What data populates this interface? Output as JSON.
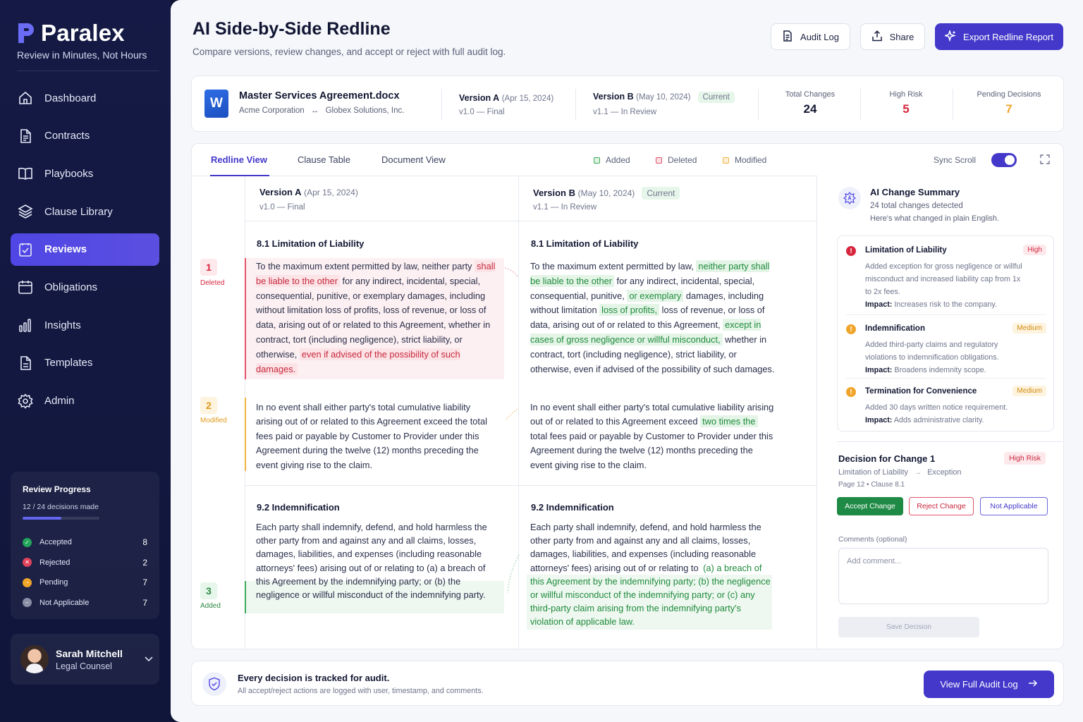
{
  "brand": {
    "name": "Paralex",
    "tagline": "Review in Minutes, Not Hours"
  },
  "nav": [
    {
      "label": "Dashboard",
      "icon": "home-icon"
    },
    {
      "label": "Contracts",
      "icon": "document-icon"
    },
    {
      "label": "Playbooks",
      "icon": "book-icon"
    },
    {
      "label": "Clause Library",
      "icon": "layers-icon"
    },
    {
      "label": "Reviews",
      "icon": "check-square-icon",
      "active": true
    },
    {
      "label": "Obligations",
      "icon": "calendar-icon"
    },
    {
      "label": "Insights",
      "icon": "bar-chart-icon"
    },
    {
      "label": "Templates",
      "icon": "file-icon"
    },
    {
      "label": "Admin",
      "icon": "gear-icon"
    }
  ],
  "progress": {
    "title": "Review Progress",
    "summary": "12 / 24 decisions made",
    "fraction": 0.5,
    "rows": [
      {
        "label": "Accepted",
        "count": "8",
        "color": "#22a55a"
      },
      {
        "label": "Rejected",
        "count": "2",
        "color": "#e0425a"
      },
      {
        "label": "Pending",
        "count": "7",
        "color": "#f0a52a"
      },
      {
        "label": "Not Applicable",
        "count": "7",
        "color": "#8a8fa6"
      }
    ]
  },
  "user": {
    "name": "Sarah Mitchell",
    "role": "Legal Counsel"
  },
  "header": {
    "title": "AI Side-by-Side Redline",
    "subtitle": "Compare versions, review changes, and accept or reject with full audit log.",
    "audit_label": "Audit Log",
    "share_label": "Share",
    "export_label": "Export Redline Report"
  },
  "doc": {
    "icon_letter": "W",
    "name": "Master Services Agreement.docx",
    "party_a": "Acme Corporation",
    "party_sep": "↔",
    "party_b": "Globex Solutions, Inc.",
    "version_a_label": "Version A",
    "version_a_date": "(Apr 15, 2024)",
    "version_a_sub": "v1.0 — Final",
    "version_b_label": "Version B",
    "version_b_date": "(May 10, 2024)",
    "version_b_sub": "v1.1 — In Review",
    "current_badge": "Current",
    "stats": [
      {
        "label": "Total Changes",
        "value": "24",
        "color": "#131833"
      },
      {
        "label": "High Risk",
        "value": "5",
        "color": "#d7263d"
      },
      {
        "label": "Pending Decisions",
        "value": "7",
        "color": "#f0a52a"
      }
    ]
  },
  "tabs": [
    "Redline View",
    "Clause Table",
    "Document View"
  ],
  "legend": [
    {
      "label": "Added",
      "color": "#3caa5a",
      "bg": "#dff3e3"
    },
    {
      "label": "Deleted",
      "color": "#e0526a",
      "bg": "#fbe0e4"
    },
    {
      "label": "Modified",
      "color": "#f1b341",
      "bg": "#fdf0d6"
    }
  ],
  "sync_label": "Sync Scroll",
  "changes": [
    {
      "num": "1",
      "label": "Deleted",
      "color": "#d7263d",
      "bg": "#fde9ec"
    },
    {
      "num": "2",
      "label": "Modified",
      "color": "#e09a1c",
      "bg": "#fdf3df"
    },
    {
      "num": "3",
      "label": "Added",
      "color": "#2f8a45",
      "bg": "#e6f6ea"
    }
  ],
  "clauses": {
    "s81": "8.1  Limitation of Liability",
    "s92": "9.2  Indemnification",
    "a1_pre": "To the maximum extent permitted by law, neither party",
    "a1_del1": "shall be liable to the other",
    "a1_mid": " for any indirect, incidental, special, consequential, punitive, or exemplary damages, including without limitation loss of profits, loss of revenue, or loss of data, arising out of or related to this Agreement, whether in contract, tort (including negligence), strict liability, or otherwise, ",
    "a1_del2": "even if advised of the possibility of such damages.",
    "b1_pre": "To the maximum extent permitted by law, ",
    "b1_add1": "neither party shall be liable to the other",
    "b1_mid1": " for any indirect, incidental, special, consequential, punitive, ",
    "b1_add2": "or exemplary",
    "b1_mid2": " damages, including without limitation ",
    "b1_add3": "loss of profits,",
    "b1_mid3": " loss of revenue, or loss of data, arising out of or related to this Agreement, ",
    "b1_add4": "except in cases of gross negligence or willful misconduct,",
    "b1_post": " whether in contract, tort (including negligence), strict liability, or otherwise, even if advised of the possibility of such damages.",
    "a2": "In no event shall either party's total cumulative liability arising out of or related to this Agreement exceed the total fees paid or payable by Customer to Provider under this Agreement during the twelve (12) months preceding the event giving rise to the claim.",
    "b2_pre": "In no event shall either party's total cumulative liability arising out of or related to this Agreement exceed ",
    "b2_add": "two times the",
    "b2_post": " total fees paid or payable by Customer to Provider under this Agreement during the twelve (12) months preceding the event giving rise to the claim.",
    "a3": "Each party shall indemnify, defend, and hold harmless the other party from and against any and all claims, losses, damages, liabilities, and expenses (including reasonable attorneys' fees) arising out of or relating to (a) a breach of this Agreement by the indemnifying party; or (b) the negligence or willful misconduct of the indemnifying party.",
    "b3_pre": "Each party shall indemnify, defend, and hold harmless the other party from and against any and all claims, losses, damages, liabilities, and expenses (including reasonable attorneys' fees) arising out of or relating to ",
    "b3_add": "(a) a breach of this Agreement by the indemnifying party; (b) the negligence or willful misconduct of the indemnifying party; or (c) any third-party claim arising from the indemnifying party's violation of applicable law."
  },
  "summary": {
    "title": "AI Change Summary",
    "sub1": "24 total changes detected",
    "sub2": "Here's what changed in plain English.",
    "impact_label": "Impact:",
    "items": [
      {
        "title": "Limitation of Liability",
        "badge": "High",
        "desc": "Added exception for gross negligence or willful misconduct and increased liability cap from 1x to 2x fees.",
        "impact": "Increases risk to the company."
      },
      {
        "title": "Indemnification",
        "badge": "Medium",
        "desc": "Added third-party claims and regulatory violations to indemnification obligations.",
        "impact": "Broadens indemnity scope."
      },
      {
        "title": "Termination for Convenience",
        "badge": "Medium",
        "desc": "Added 30 days written notice requirement.",
        "impact": "Adds administrative clarity."
      }
    ]
  },
  "decision": {
    "title": "Decision for Change 1",
    "risk": "High Risk",
    "path_from": "Limitation of Liability",
    "path_to": "Exception",
    "page": "Page 12  •  Clause 8.1",
    "accept": "Accept Change",
    "reject": "Reject Change",
    "na": "Not Applicable",
    "comments_label": "Comments (optional)",
    "comment_placeholder": "Add comment...",
    "save": "Save Decision"
  },
  "audit": {
    "title": "Every decision is tracked for audit.",
    "sub": "All accept/reject actions are logged with user, timestamp, and comments.",
    "button": "View Full Audit Log"
  }
}
